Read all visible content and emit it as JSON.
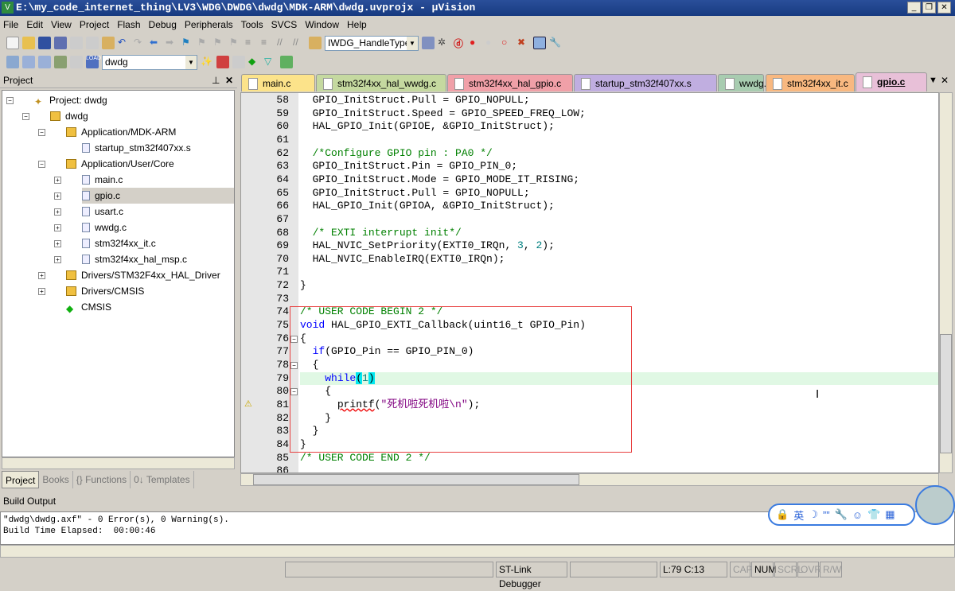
{
  "window": {
    "title": "E:\\my_code_internet_thing\\LV3\\WDG\\DWDG\\dwdg\\MDK-ARM\\dwdg.uvprojx - µVision",
    "app_icon": "V"
  },
  "menu": [
    "File",
    "Edit",
    "View",
    "Project",
    "Flash",
    "Debug",
    "Peripherals",
    "Tools",
    "SVCS",
    "Window",
    "Help"
  ],
  "toolbar": {
    "find_combo": "IWDG_HandleTypeD",
    "target_combo": "dwdg"
  },
  "project_panel": {
    "title": "Project",
    "tree": [
      {
        "label": "Project: dwdg",
        "level": 0,
        "type": "project",
        "expanded": true
      },
      {
        "label": "dwdg",
        "level": 1,
        "type": "target",
        "expanded": true
      },
      {
        "label": "Application/MDK-ARM",
        "level": 2,
        "type": "folder",
        "expanded": true
      },
      {
        "label": "startup_stm32f407xx.s",
        "level": 3,
        "type": "file"
      },
      {
        "label": "Application/User/Core",
        "level": 2,
        "type": "folder",
        "expanded": true
      },
      {
        "label": "main.c",
        "level": 3,
        "type": "file",
        "expandable": true
      },
      {
        "label": "gpio.c",
        "level": 3,
        "type": "file",
        "expandable": true,
        "selected": true
      },
      {
        "label": "usart.c",
        "level": 3,
        "type": "file",
        "expandable": true
      },
      {
        "label": "wwdg.c",
        "level": 3,
        "type": "file",
        "expandable": true
      },
      {
        "label": "stm32f4xx_it.c",
        "level": 3,
        "type": "file",
        "expandable": true
      },
      {
        "label": "stm32f4xx_hal_msp.c",
        "level": 3,
        "type": "file",
        "expandable": true
      },
      {
        "label": "Drivers/STM32F4xx_HAL_Driver",
        "level": 2,
        "type": "folder",
        "expanded": false
      },
      {
        "label": "Drivers/CMSIS",
        "level": 2,
        "type": "folder",
        "expanded": false
      },
      {
        "label": "CMSIS",
        "level": 2,
        "type": "component"
      }
    ],
    "tabs": [
      {
        "label": "Project",
        "active": true
      },
      {
        "label": "Books"
      },
      {
        "label": "{} Functions"
      },
      {
        "label": "0↓ Templates"
      }
    ]
  },
  "editor_tabs": [
    {
      "label": "main.c",
      "color": "#fce38a"
    },
    {
      "label": "stm32f4xx_hal_wwdg.c",
      "color": "#c5d9a0"
    },
    {
      "label": "stm32f4xx_hal_gpio.c",
      "color": "#f0a0a8"
    },
    {
      "label": "startup_stm32f407xx.s",
      "color": "#c0aee0"
    },
    {
      "label": "wwdg.c",
      "color": "#a8ccb0"
    },
    {
      "label": "stm32f4xx_it.c",
      "color": "#f8b880"
    },
    {
      "label": "gpio.c",
      "color": "#e8c0d8",
      "active": true
    }
  ],
  "code": [
    {
      "n": 58,
      "t": [
        [
          "",
          "  GPIO_InitStruct.Pull = GPIO_NOPULL;"
        ]
      ]
    },
    {
      "n": 59,
      "t": [
        [
          "",
          "  GPIO_InitStruct.Speed = GPIO_SPEED_FREQ_LOW;"
        ]
      ]
    },
    {
      "n": 60,
      "t": [
        [
          "",
          "  HAL_GPIO_Init(GPIOE, &GPIO_InitStruct);"
        ]
      ]
    },
    {
      "n": 61,
      "t": []
    },
    {
      "n": 62,
      "t": [
        [
          "",
          "  "
        ],
        [
          "cm",
          "/*Configure GPIO pin : PA0 */"
        ]
      ]
    },
    {
      "n": 63,
      "t": [
        [
          "",
          "  GPIO_InitStruct.Pin = GPIO_PIN_0;"
        ]
      ]
    },
    {
      "n": 64,
      "t": [
        [
          "",
          "  GPIO_InitStruct.Mode = GPIO_MODE_IT_RISING;"
        ]
      ]
    },
    {
      "n": 65,
      "t": [
        [
          "",
          "  GPIO_InitStruct.Pull = GPIO_NOPULL;"
        ]
      ]
    },
    {
      "n": 66,
      "t": [
        [
          "",
          "  HAL_GPIO_Init(GPIOA, &GPIO_InitStruct);"
        ]
      ]
    },
    {
      "n": 67,
      "t": []
    },
    {
      "n": 68,
      "t": [
        [
          "",
          "  "
        ],
        [
          "cm",
          "/* EXTI interrupt init*/"
        ]
      ]
    },
    {
      "n": 69,
      "t": [
        [
          "",
          "  HAL_NVIC_SetPriority(EXTI0_IRQn, "
        ],
        [
          "num",
          "3"
        ],
        [
          "",
          ", "
        ],
        [
          "num",
          "2"
        ],
        [
          "",
          ");"
        ]
      ]
    },
    {
      "n": 70,
      "t": [
        [
          "",
          "  HAL_NVIC_EnableIRQ(EXTI0_IRQn);"
        ]
      ]
    },
    {
      "n": 71,
      "t": []
    },
    {
      "n": 72,
      "t": [
        [
          "",
          "}"
        ]
      ]
    },
    {
      "n": 73,
      "t": []
    },
    {
      "n": 74,
      "t": [
        [
          "cm",
          "/* USER CODE BEGIN 2 */"
        ]
      ]
    },
    {
      "n": 75,
      "t": [
        [
          "kw",
          "void"
        ],
        [
          "",
          " HAL_GPIO_EXTI_Callback(uint16_t GPIO_Pin)"
        ]
      ]
    },
    {
      "n": 76,
      "t": [
        [
          "",
          "{"
        ]
      ],
      "fold": true
    },
    {
      "n": 77,
      "t": [
        [
          "",
          "  "
        ],
        [
          "kw",
          "if"
        ],
        [
          "",
          "(GPIO_Pin == GPIO_PIN_0)"
        ]
      ]
    },
    {
      "n": 78,
      "t": [
        [
          "",
          "  {"
        ]
      ],
      "fold": true
    },
    {
      "n": 79,
      "t": [
        [
          "",
          "    "
        ],
        [
          "kw",
          "while"
        ],
        [
          "br",
          "("
        ],
        [
          "num",
          "1"
        ],
        [
          "br",
          ")"
        ]
      ],
      "current": true
    },
    {
      "n": 80,
      "t": [
        [
          "",
          "    {"
        ]
      ],
      "fold": true
    },
    {
      "n": 81,
      "t": [
        [
          "",
          "      "
        ],
        [
          "err",
          "printf"
        ],
        [
          "",
          "("
        ],
        [
          "str",
          "\"死机啦死机啦\\n\""
        ],
        [
          "",
          ");"
        ]
      ],
      "warning": true
    },
    {
      "n": 82,
      "t": [
        [
          "",
          "    }"
        ]
      ]
    },
    {
      "n": 83,
      "t": [
        [
          "",
          "  }"
        ]
      ]
    },
    {
      "n": 84,
      "t": [
        [
          "",
          "}"
        ]
      ]
    },
    {
      "n": 85,
      "t": [
        [
          "cm",
          "/* USER CODE END 2 */"
        ]
      ]
    },
    {
      "n": 86,
      "t": []
    }
  ],
  "build_output": {
    "title": "Build Output",
    "lines": [
      "\"dwdg\\dwdg.axf\" - 0 Error(s), 0 Warning(s).",
      "Build Time Elapsed:  00:00:46"
    ]
  },
  "status": {
    "debugger": "ST-Link Debugger",
    "position": "L:79 C:13",
    "cap": "CAP",
    "num": "NUM",
    "scrl": "SCRL",
    "ovr": "OVR",
    "rw": "R/W"
  },
  "ime": {
    "items": [
      "🔒",
      "英",
      "☽",
      "””",
      "🔧",
      "☺",
      "👕",
      "▦"
    ]
  }
}
